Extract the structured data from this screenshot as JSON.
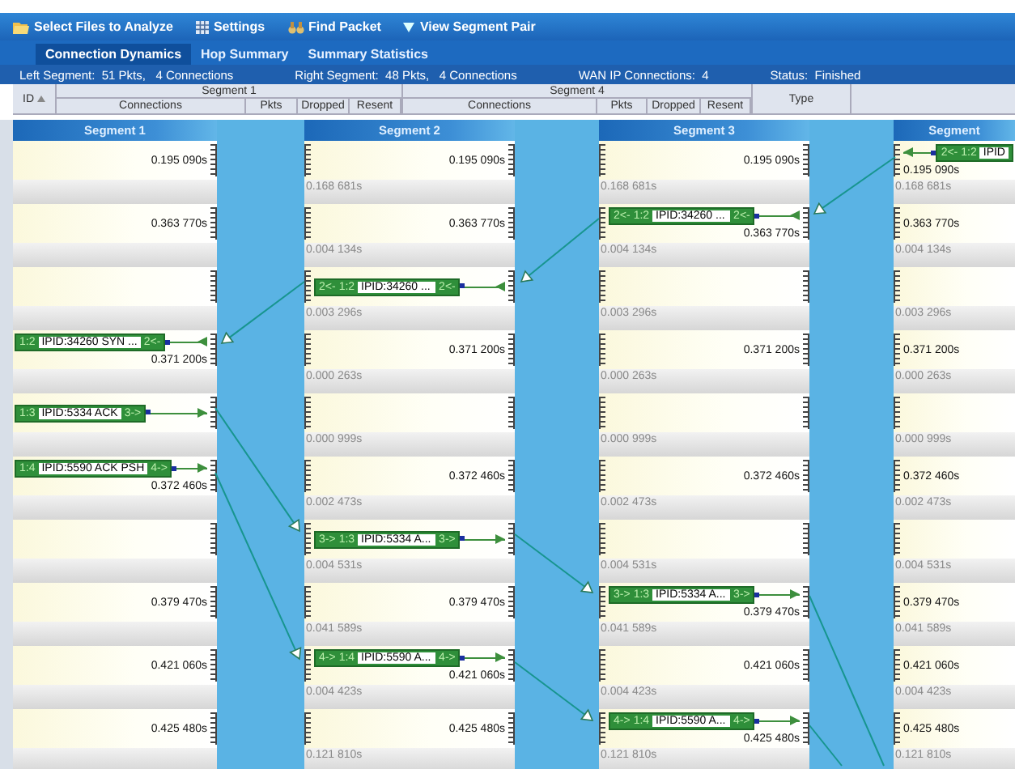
{
  "toolbar": [
    {
      "kind": "folder",
      "label": "Select Files to Analyze"
    },
    {
      "kind": "grid",
      "label": "Settings"
    },
    {
      "kind": "binoculars",
      "label": "Find Packet"
    },
    {
      "kind": "triangle",
      "label": "View Segment Pair"
    }
  ],
  "tabs": [
    {
      "label": "Connection Dynamics",
      "selected": true
    },
    {
      "label": "Hop Summary",
      "selected": false
    },
    {
      "label": "Summary Statistics",
      "selected": false
    }
  ],
  "status": [
    {
      "label": "Left Segment:",
      "value": "51 Pkts,   4 Connections"
    },
    {
      "label": "Right Segment:",
      "value": "48 Pkts,   4 Connections"
    },
    {
      "label": "WAN IP Connections:",
      "value": "4"
    },
    {
      "label": "Status:",
      "value": "Finished"
    }
  ],
  "table": {
    "id_column": {
      "label": "ID",
      "sorted": true
    },
    "groups": [
      {
        "label": "Segment 1",
        "columns": [
          "Connections",
          "Pkts",
          "Dropped",
          "Resent"
        ]
      },
      {
        "label": "Segment 4",
        "columns": [
          "Connections",
          "Pkts",
          "Dropped",
          "Resent"
        ]
      }
    ],
    "type_column": "Type"
  },
  "segments": [
    {
      "name": "Segment 1",
      "kind": "first",
      "rows": [
        {
          "time": "0.195 090s"
        },
        {
          "time": "0.363 770s"
        },
        {},
        {
          "time": "0.371 200s",
          "packet": {
            "kind": "inbound",
            "id": "1:2",
            "label": "IPID:34260 SYN ...",
            "suffix": "2<-"
          }
        },
        {
          "packet": {
            "kind": "outbound",
            "id": "1:3",
            "label": "IPID:5334 ACK",
            "suffix": "3->"
          }
        },
        {
          "time": "0.372 460s",
          "packet": {
            "kind": "outbound",
            "id": "1:4",
            "label": "IPID:5590 ACK PSH",
            "suffix": "4->"
          }
        },
        {},
        {
          "time": "0.379 470s"
        },
        {
          "time": "0.421 060s"
        },
        {
          "time": "0.425 480s"
        }
      ]
    },
    {
      "name": "Segment 2",
      "kind": "middle",
      "rows": [
        {
          "time": "0.195 090s",
          "delta": "0.168 681s"
        },
        {
          "time": "0.363 770s",
          "delta": "0.004 134s"
        },
        {
          "delta": "0.003 296s",
          "packet": {
            "kind": "inbound",
            "prefix": "2<-",
            "id": "1:2",
            "label": "IPID:34260 ...",
            "suffix": "2<-"
          }
        },
        {
          "time": "0.371 200s",
          "delta": "0.000 263s"
        },
        {
          "delta": "0.000 999s"
        },
        {
          "time": "0.372 460s",
          "delta": "0.002 473s"
        },
        {
          "delta": "0.004 531s",
          "packet": {
            "kind": "outbound",
            "prefix": "3->",
            "id": "1:3",
            "label": "IPID:5334 A...",
            "suffix": "3->"
          }
        },
        {
          "time": "0.379 470s",
          "delta": "0.041 589s"
        },
        {
          "time": "0.421 060s",
          "delta": "0.004 423s",
          "packet": {
            "kind": "outbound",
            "prefix": "4->",
            "id": "1:4",
            "label": "IPID:5590 A...",
            "suffix": "4->"
          }
        },
        {
          "time": "0.425 480s",
          "delta": "0.121 810s"
        }
      ]
    },
    {
      "name": "Segment 3",
      "kind": "middle",
      "rows": [
        {
          "time": "0.195 090s",
          "delta": "0.168 681s"
        },
        {
          "time": "0.363 770s",
          "delta": "0.004 134s",
          "packet": {
            "kind": "inbound",
            "prefix": "2<-",
            "id": "1:2",
            "label": "IPID:34260 ...",
            "suffix": "2<-"
          }
        },
        {
          "delta": "0.003 296s"
        },
        {
          "time": "0.371 200s",
          "delta": "0.000 263s"
        },
        {
          "delta": "0.000 999s"
        },
        {
          "time": "0.372 460s",
          "delta": "0.002 473s"
        },
        {
          "delta": "0.004 531s"
        },
        {
          "time": "0.379 470s",
          "delta": "0.041 589s",
          "packet": {
            "kind": "outbound",
            "prefix": "3->",
            "id": "1:3",
            "label": "IPID:5334 A...",
            "suffix": "3->"
          }
        },
        {
          "time": "0.421 060s",
          "delta": "0.004 423s"
        },
        {
          "time": "0.425 480s",
          "delta": "0.121 810s",
          "packet": {
            "kind": "outbound",
            "prefix": "4->",
            "id": "1:4",
            "label": "IPID:5590 A...",
            "suffix": "4->"
          }
        }
      ]
    },
    {
      "name": "Segment",
      "kind": "last",
      "rows": [
        {
          "time": "0.195 090s",
          "delta": "0.168 681s",
          "packet": {
            "kind": "inbound",
            "prefix": "2<-",
            "id": "1:2",
            "label": "IPID"
          }
        },
        {
          "time": "0.363 770s",
          "delta": "0.004 134s"
        },
        {
          "delta": "0.003 296s"
        },
        {
          "time": "0.371 200s",
          "delta": "0.000 263s"
        },
        {
          "delta": "0.000 999s"
        },
        {
          "time": "0.372 460s",
          "delta": "0.002 473s"
        },
        {
          "delta": "0.004 531s"
        },
        {
          "time": "0.379 470s",
          "delta": "0.041 589s"
        },
        {
          "time": "0.421 060s",
          "delta": "0.004 423s"
        },
        {
          "time": "0.425 480s",
          "delta": "0.121 810s"
        }
      ]
    }
  ]
}
